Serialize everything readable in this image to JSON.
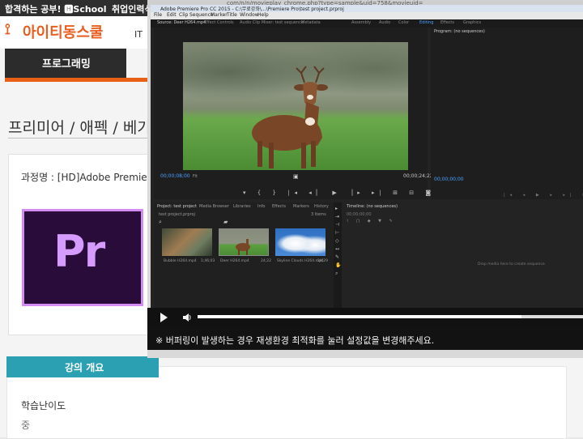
{
  "site": {
    "top_strip_left": "합격하는 공부! 🅷School",
    "top_strip_right": "취업인력식",
    "logo_text": "아이티동스쿨",
    "header_fragment": "IT",
    "menu_tab": "프로그래밍",
    "course_title": "프리미어 / 애펙 / 베가",
    "course_name": "과정명 : [HD]Adobe Premiere",
    "pr_logo_text": "Pr",
    "overview_tab": "강의 개요",
    "difficulty_label": "학습난이도",
    "difficulty_value": "중"
  },
  "player": {
    "url": "com/n/n/movieplay_chrome.php?type=sample&uid=758&movieuid=",
    "notice": "※ 버퍼링이 발생하는 경우 재생환경 최적화를 눌러 설정값을 변경해주세요.",
    "progress_fraction": 0.84
  },
  "premiere": {
    "title": "Adobe Premiere Pro CC 2015 - C:\\무료강좌\\...\\Premiere Pro\\test project.prproj",
    "menus": [
      "File",
      "Edit",
      "Clip",
      "Sequence",
      "Marker",
      "Title",
      "Window",
      "Help"
    ],
    "workspace_tabs": [
      "Source: Deer H264.mp4",
      "Effect Controls",
      "Audio Clip Mixer: test sequence",
      "Metadata",
      "Assembly",
      "Audio",
      "Color",
      "Editing",
      "Effects",
      "Graphics"
    ],
    "source_timecode": "00;00;08;00",
    "source_fit": "Fit",
    "source_duration": "00;00;24;22",
    "program_tab": "Program: (no sequences)",
    "program_timecode": "00;00;00;00",
    "project_tabs": [
      "Project: test project",
      "Media Browser",
      "Libraries",
      "Info",
      "Effects",
      "Markers",
      "History"
    ],
    "project_file": "test project.prproj",
    "item_count": "3 Items",
    "clips": [
      {
        "name": "Bubble H264.mp4",
        "duration": "1;46;03"
      },
      {
        "name": "Deer H264.mp4",
        "duration": "24;22"
      },
      {
        "name": "Skyline Clouds H264.mp4",
        "duration": "24;29"
      }
    ],
    "timeline_tab": "Timeline: (no sequences)",
    "timeline_timecode": "00;00;00;00",
    "timeline_hint": "Drop media here to create sequence."
  },
  "colors": {
    "brand_orange": "#e85f16",
    "accent_teal": "#2aa0b2",
    "premiere_purple": "#d59bff",
    "timecode_blue": "#4aa0ff"
  }
}
